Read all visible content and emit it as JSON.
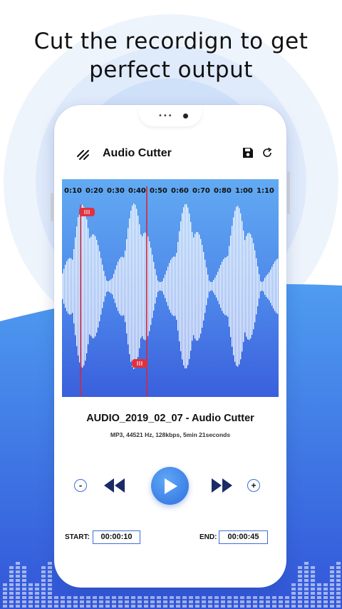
{
  "headline": {
    "line1": "Cut the recordign to get",
    "line2": "perfect output"
  },
  "app": {
    "title": "Audio Cutter",
    "menu_icon": "menu-icon",
    "save_icon": "save-icon",
    "refresh_icon": "refresh-icon"
  },
  "timeline": {
    "ticks": [
      "0:10",
      "0:20",
      "0:30",
      "0:40",
      "0:50",
      "0:60",
      "0:70",
      "0:80",
      "1:00",
      "1:10"
    ]
  },
  "track": {
    "name": "AUDIO_2019_02_07 - Audio Cutter",
    "info": "MP3, 44521 Hz, 128kbps, 5min 21seconds"
  },
  "controls": {
    "zoom_out": "-",
    "zoom_in": "+",
    "rewind_icon": "rewind-icon",
    "play_icon": "play-icon",
    "forward_icon": "fast-forward-icon"
  },
  "range": {
    "start_label": "START:",
    "start_value": "00:00:10",
    "end_label": "END:",
    "end_value": "00:00:45"
  },
  "colors": {
    "accent": "#3d7be6",
    "waveform": "#4a7fe8",
    "marker": "#e0313f"
  }
}
